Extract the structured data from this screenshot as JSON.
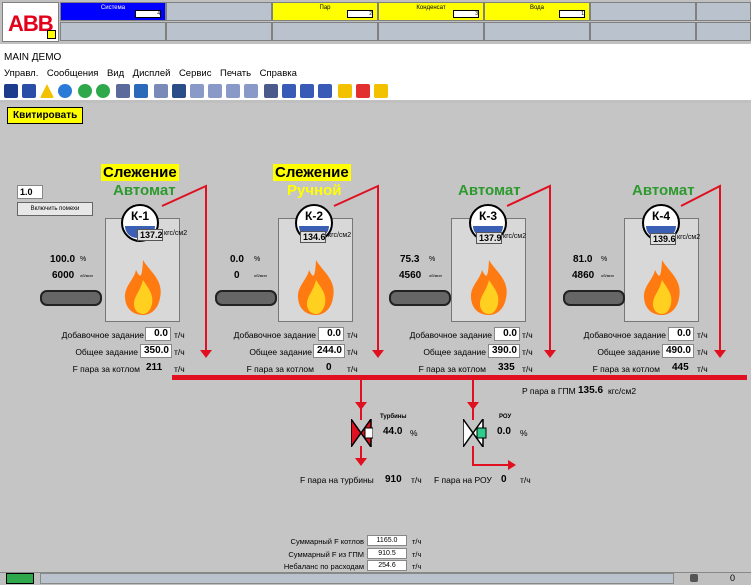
{
  "topbar": {
    "cells": [
      {
        "label": "Система",
        "num": "4",
        "color": "#0000ff",
        "text_color": "#ffffff"
      },
      {
        "label": "",
        "num": "",
        "color": "#b9c2cd"
      },
      {
        "label": "Пар",
        "num": "2",
        "color": "#ffff00"
      },
      {
        "label": "Конденсат",
        "num": "3",
        "color": "#ffff00"
      },
      {
        "label": "Вода",
        "num": "1",
        "color": "#ffff00"
      },
      {
        "label": "",
        "num": "",
        "color": "#b9c2cd"
      },
      {
        "label": "",
        "num": "",
        "color": "#b9c2cd"
      }
    ]
  },
  "logo": "ABB",
  "window_title": "MAIN ДЕМО",
  "menu": [
    "Управл.",
    "Сообщения",
    "Вид",
    "Дисплей",
    "Сервис",
    "Печать",
    "Справка"
  ],
  "ack_button": "Квитировать",
  "setpoint": {
    "value": "1.0",
    "button": "Включить помехи"
  },
  "boilers": [
    {
      "name": "К-1",
      "top_status": "Слежение",
      "mode": "Автомат",
      "mode_color": "#2e9a2e",
      "pressure": "137.2",
      "unit": "кгс/см2",
      "load": "100.0",
      "load_unit": "%",
      "rpm": "6000",
      "rpm_unit": "об/мин",
      "add_label": "Добавочное задание",
      "add": "0.0",
      "total_label": "Общее задание",
      "total": "350.0",
      "steam_label": "F пара за котлом",
      "steam": "211",
      "flow_unit": "т/ч"
    },
    {
      "name": "К-2",
      "top_status": "Слежение",
      "mode": "Ручной",
      "mode_color": "#ffff00",
      "pressure": "134.6",
      "unit": "кгс/см2",
      "load": "0.0",
      "load_unit": "%",
      "rpm": "0",
      "rpm_unit": "об/мин",
      "add_label": "Добавочное задание",
      "add": "0.0",
      "total_label": "Общее задание",
      "total": "244.0",
      "steam_label": "F пара за котлом",
      "steam": "0",
      "flow_unit": "т/ч"
    },
    {
      "name": "К-3",
      "top_status": "",
      "mode": "Автомат",
      "mode_color": "#2e9a2e",
      "pressure": "137.9",
      "unit": "кгс/см2",
      "load": "75.3",
      "load_unit": "%",
      "rpm": "4560",
      "rpm_unit": "об/мин",
      "add_label": "Добавочное задание",
      "add": "0.0",
      "total_label": "Общее задание",
      "total": "390.0",
      "steam_label": "F пара за котлом",
      "steam": "335",
      "flow_unit": "т/ч"
    },
    {
      "name": "К-4",
      "top_status": "",
      "mode": "Автомат",
      "mode_color": "#2e9a2e",
      "pressure": "139.6",
      "unit": "кгс/см2",
      "load": "81.0",
      "load_unit": "%",
      "rpm": "4860",
      "rpm_unit": "об/мин",
      "add_label": "Добавочное задание",
      "add": "0.0",
      "total_label": "Общее задание",
      "total": "490.0",
      "steam_label": "F пара за котлом",
      "steam": "445",
      "flow_unit": "т/ч"
    }
  ],
  "header_pressure": {
    "label": "P пара в ГПМ",
    "value": "135.6",
    "unit": "кгс/см2"
  },
  "valves": {
    "turbine": {
      "label": "Турбины",
      "value": "44.0",
      "unit": "%"
    },
    "rou": {
      "label": "РОУ",
      "value": "0.0",
      "unit": "%"
    }
  },
  "flows": {
    "turbine_label": "F пара на турбины",
    "turbine_value": "910",
    "turbine_unit": "т/ч",
    "rou_label": "F пара на РОУ",
    "rou_value": "0",
    "rou_unit": "т/ч"
  },
  "summary": [
    {
      "label": "Суммарный F котлов",
      "value": "1165.0",
      "unit": "т/ч"
    },
    {
      "label": "Суммарный F из ГПМ",
      "value": "910.5",
      "unit": "т/ч"
    },
    {
      "label": "Небаланс по расходам",
      "value": "254.6",
      "unit": "т/ч"
    }
  ],
  "status_bar": {
    "counter": "0"
  }
}
